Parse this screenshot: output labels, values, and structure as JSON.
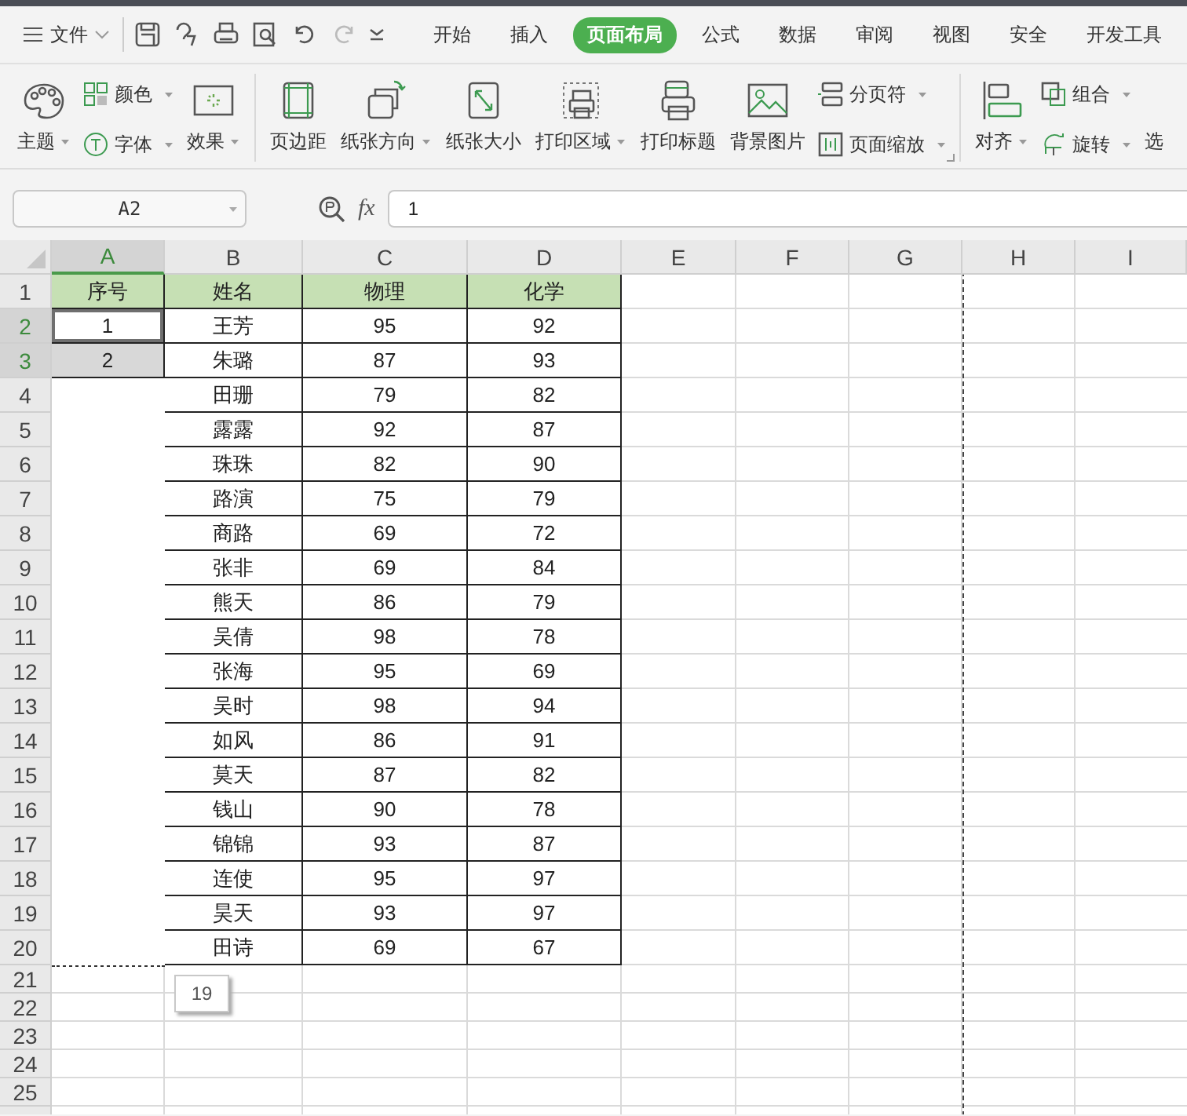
{
  "menu_bar": {
    "file_menu": "文件",
    "tabs": [
      {
        "label": "开始",
        "selected": false
      },
      {
        "label": "插入",
        "selected": false
      },
      {
        "label": "页面布局",
        "selected": true
      },
      {
        "label": "公式",
        "selected": false
      },
      {
        "label": "数据",
        "selected": false
      },
      {
        "label": "审阅",
        "selected": false
      },
      {
        "label": "视图",
        "selected": false
      },
      {
        "label": "安全",
        "selected": false
      },
      {
        "label": "开发工具",
        "selected": false
      }
    ]
  },
  "ribbon": {
    "groups": [
      {
        "items": [
          {
            "kind": "large",
            "label": "主题",
            "dropdown": true
          },
          {
            "kind": "stack",
            "items": [
              {
                "label": "颜色",
                "dropdown": true
              },
              {
                "label": "字体",
                "dropdown": true
              }
            ]
          },
          {
            "kind": "large",
            "label": "效果",
            "dropdown": true
          }
        ]
      },
      {
        "items": [
          {
            "kind": "large",
            "label": "页边距",
            "dropdown": false
          },
          {
            "kind": "large",
            "label": "纸张方向",
            "dropdown": true
          },
          {
            "kind": "large",
            "label": "纸张大小",
            "dropdown": false
          },
          {
            "kind": "large",
            "label": "打印区域",
            "dropdown": true
          },
          {
            "kind": "large",
            "label": "打印标题",
            "dropdown": false
          },
          {
            "kind": "large",
            "label": "背景图片",
            "dropdown": false
          },
          {
            "kind": "stack",
            "items": [
              {
                "label": "分页符",
                "dropdown": true
              },
              {
                "label": "页面缩放",
                "dropdown": true
              }
            ]
          }
        ]
      },
      {
        "items": [
          {
            "kind": "large",
            "label": "对齐",
            "dropdown": true
          },
          {
            "kind": "stack",
            "items": [
              {
                "label": "组合",
                "dropdown": true
              },
              {
                "label": "旋转",
                "dropdown": true
              }
            ]
          },
          {
            "kind": "large",
            "label": "选",
            "dropdown": false
          }
        ]
      }
    ]
  },
  "formula_bar": {
    "name_box": "A2",
    "function_label": "fx",
    "formula": "1"
  },
  "sheet": {
    "columns": [
      {
        "label": "A",
        "selected": true
      },
      {
        "label": "B",
        "selected": false
      },
      {
        "label": "C",
        "selected": false
      },
      {
        "label": "D",
        "selected": false
      },
      {
        "label": "E",
        "selected": false
      },
      {
        "label": "F",
        "selected": false
      },
      {
        "label": "G",
        "selected": false
      },
      {
        "label": "H",
        "selected": false
      },
      {
        "label": "I",
        "selected": false
      }
    ],
    "rows": [
      {
        "label": "1",
        "kind": "header",
        "selected": false,
        "cells": [
          "序号",
          "姓名",
          "物理",
          "化学"
        ]
      },
      {
        "label": "2",
        "kind": "data",
        "selected": true,
        "cells": [
          "1",
          "王芳",
          "95",
          "92"
        ]
      },
      {
        "label": "3",
        "kind": "data",
        "selected": true,
        "cells": [
          "2",
          "朱璐",
          "87",
          "93"
        ]
      },
      {
        "label": "4",
        "kind": "data",
        "selected": false,
        "cells": [
          null,
          "田珊",
          "79",
          "82"
        ]
      },
      {
        "label": "5",
        "kind": "data",
        "selected": false,
        "cells": [
          null,
          "露露",
          "92",
          "87"
        ]
      },
      {
        "label": "6",
        "kind": "data",
        "selected": false,
        "cells": [
          null,
          "珠珠",
          "82",
          "90"
        ]
      },
      {
        "label": "7",
        "kind": "data",
        "selected": false,
        "cells": [
          null,
          "路演",
          "75",
          "79"
        ]
      },
      {
        "label": "8",
        "kind": "data",
        "selected": false,
        "cells": [
          null,
          "商路",
          "69",
          "72"
        ]
      },
      {
        "label": "9",
        "kind": "data",
        "selected": false,
        "cells": [
          null,
          "张非",
          "69",
          "84"
        ]
      },
      {
        "label": "10",
        "kind": "data",
        "selected": false,
        "cells": [
          null,
          "熊天",
          "86",
          "79"
        ]
      },
      {
        "label": "11",
        "kind": "data",
        "selected": false,
        "cells": [
          null,
          "吴倩",
          "98",
          "78"
        ]
      },
      {
        "label": "12",
        "kind": "data",
        "selected": false,
        "cells": [
          null,
          "张海",
          "95",
          "69"
        ]
      },
      {
        "label": "13",
        "kind": "data",
        "selected": false,
        "cells": [
          null,
          "吴时",
          "98",
          "94"
        ]
      },
      {
        "label": "14",
        "kind": "data",
        "selected": false,
        "cells": [
          null,
          "如风",
          "86",
          "91"
        ]
      },
      {
        "label": "15",
        "kind": "data",
        "selected": false,
        "cells": [
          null,
          "莫天",
          "87",
          "82"
        ]
      },
      {
        "label": "16",
        "kind": "data",
        "selected": false,
        "cells": [
          null,
          "钱山",
          "90",
          "78"
        ]
      },
      {
        "label": "17",
        "kind": "data",
        "selected": false,
        "cells": [
          null,
          "锦锦",
          "93",
          "87"
        ]
      },
      {
        "label": "18",
        "kind": "data",
        "selected": false,
        "cells": [
          null,
          "连使",
          "95",
          "97"
        ]
      },
      {
        "label": "19",
        "kind": "data",
        "selected": false,
        "cells": [
          null,
          "昊天",
          "93",
          "97"
        ]
      },
      {
        "label": "20",
        "kind": "data",
        "selected": false,
        "cells": [
          null,
          "田诗",
          "69",
          "67"
        ]
      },
      {
        "label": "21",
        "kind": "empty",
        "selected": false
      },
      {
        "label": "22",
        "kind": "empty",
        "selected": false
      },
      {
        "label": "23",
        "kind": "empty",
        "selected": false
      },
      {
        "label": "24",
        "kind": "empty",
        "selected": false
      },
      {
        "label": "25",
        "kind": "empty",
        "selected": false
      }
    ],
    "fill_tooltip": "19"
  }
}
